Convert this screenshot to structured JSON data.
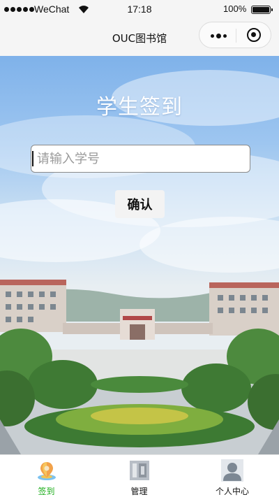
{
  "status_bar": {
    "carrier": "WeChat",
    "time": "17:18",
    "battery": "100%",
    "battery_level": 1.0
  },
  "nav": {
    "title": "OUC图书馆",
    "more_icon": "more-dots-icon",
    "close_icon": "mini-program-close-icon"
  },
  "main": {
    "title": "学生签到",
    "input": {
      "placeholder": "请输入学号",
      "value": ""
    },
    "confirm_label": "确认"
  },
  "tabbar": {
    "items": [
      {
        "label": "签到",
        "icon": "location-pin-icon",
        "active": true
      },
      {
        "label": "管理",
        "icon": "manage-icon",
        "active": false
      },
      {
        "label": "个人中心",
        "icon": "user-icon",
        "active": false
      }
    ],
    "active_color": "#1aad19"
  }
}
